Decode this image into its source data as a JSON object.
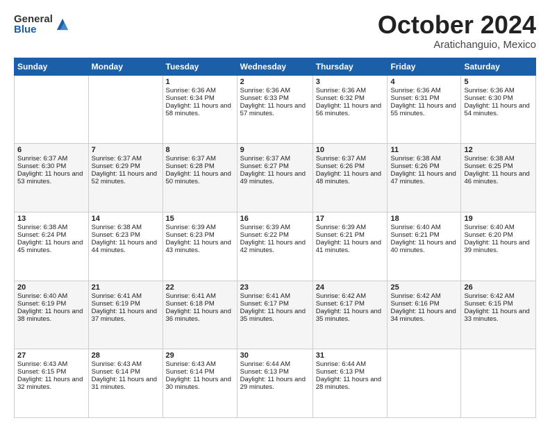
{
  "logo": {
    "general": "General",
    "blue": "Blue"
  },
  "title": "October 2024",
  "location": "Aratichanguio, Mexico",
  "header_days": [
    "Sunday",
    "Monday",
    "Tuesday",
    "Wednesday",
    "Thursday",
    "Friday",
    "Saturday"
  ],
  "weeks": [
    [
      {
        "day": "",
        "sunrise": "",
        "sunset": "",
        "daylight": ""
      },
      {
        "day": "",
        "sunrise": "",
        "sunset": "",
        "daylight": ""
      },
      {
        "day": "1",
        "sunrise": "Sunrise: 6:36 AM",
        "sunset": "Sunset: 6:34 PM",
        "daylight": "Daylight: 11 hours and 58 minutes."
      },
      {
        "day": "2",
        "sunrise": "Sunrise: 6:36 AM",
        "sunset": "Sunset: 6:33 PM",
        "daylight": "Daylight: 11 hours and 57 minutes."
      },
      {
        "day": "3",
        "sunrise": "Sunrise: 6:36 AM",
        "sunset": "Sunset: 6:32 PM",
        "daylight": "Daylight: 11 hours and 56 minutes."
      },
      {
        "day": "4",
        "sunrise": "Sunrise: 6:36 AM",
        "sunset": "Sunset: 6:31 PM",
        "daylight": "Daylight: 11 hours and 55 minutes."
      },
      {
        "day": "5",
        "sunrise": "Sunrise: 6:36 AM",
        "sunset": "Sunset: 6:30 PM",
        "daylight": "Daylight: 11 hours and 54 minutes."
      }
    ],
    [
      {
        "day": "6",
        "sunrise": "Sunrise: 6:37 AM",
        "sunset": "Sunset: 6:30 PM",
        "daylight": "Daylight: 11 hours and 53 minutes."
      },
      {
        "day": "7",
        "sunrise": "Sunrise: 6:37 AM",
        "sunset": "Sunset: 6:29 PM",
        "daylight": "Daylight: 11 hours and 52 minutes."
      },
      {
        "day": "8",
        "sunrise": "Sunrise: 6:37 AM",
        "sunset": "Sunset: 6:28 PM",
        "daylight": "Daylight: 11 hours and 50 minutes."
      },
      {
        "day": "9",
        "sunrise": "Sunrise: 6:37 AM",
        "sunset": "Sunset: 6:27 PM",
        "daylight": "Daylight: 11 hours and 49 minutes."
      },
      {
        "day": "10",
        "sunrise": "Sunrise: 6:37 AM",
        "sunset": "Sunset: 6:26 PM",
        "daylight": "Daylight: 11 hours and 48 minutes."
      },
      {
        "day": "11",
        "sunrise": "Sunrise: 6:38 AM",
        "sunset": "Sunset: 6:26 PM",
        "daylight": "Daylight: 11 hours and 47 minutes."
      },
      {
        "day": "12",
        "sunrise": "Sunrise: 6:38 AM",
        "sunset": "Sunset: 6:25 PM",
        "daylight": "Daylight: 11 hours and 46 minutes."
      }
    ],
    [
      {
        "day": "13",
        "sunrise": "Sunrise: 6:38 AM",
        "sunset": "Sunset: 6:24 PM",
        "daylight": "Daylight: 11 hours and 45 minutes."
      },
      {
        "day": "14",
        "sunrise": "Sunrise: 6:38 AM",
        "sunset": "Sunset: 6:23 PM",
        "daylight": "Daylight: 11 hours and 44 minutes."
      },
      {
        "day": "15",
        "sunrise": "Sunrise: 6:39 AM",
        "sunset": "Sunset: 6:23 PM",
        "daylight": "Daylight: 11 hours and 43 minutes."
      },
      {
        "day": "16",
        "sunrise": "Sunrise: 6:39 AM",
        "sunset": "Sunset: 6:22 PM",
        "daylight": "Daylight: 11 hours and 42 minutes."
      },
      {
        "day": "17",
        "sunrise": "Sunrise: 6:39 AM",
        "sunset": "Sunset: 6:21 PM",
        "daylight": "Daylight: 11 hours and 41 minutes."
      },
      {
        "day": "18",
        "sunrise": "Sunrise: 6:40 AM",
        "sunset": "Sunset: 6:21 PM",
        "daylight": "Daylight: 11 hours and 40 minutes."
      },
      {
        "day": "19",
        "sunrise": "Sunrise: 6:40 AM",
        "sunset": "Sunset: 6:20 PM",
        "daylight": "Daylight: 11 hours and 39 minutes."
      }
    ],
    [
      {
        "day": "20",
        "sunrise": "Sunrise: 6:40 AM",
        "sunset": "Sunset: 6:19 PM",
        "daylight": "Daylight: 11 hours and 38 minutes."
      },
      {
        "day": "21",
        "sunrise": "Sunrise: 6:41 AM",
        "sunset": "Sunset: 6:19 PM",
        "daylight": "Daylight: 11 hours and 37 minutes."
      },
      {
        "day": "22",
        "sunrise": "Sunrise: 6:41 AM",
        "sunset": "Sunset: 6:18 PM",
        "daylight": "Daylight: 11 hours and 36 minutes."
      },
      {
        "day": "23",
        "sunrise": "Sunrise: 6:41 AM",
        "sunset": "Sunset: 6:17 PM",
        "daylight": "Daylight: 11 hours and 35 minutes."
      },
      {
        "day": "24",
        "sunrise": "Sunrise: 6:42 AM",
        "sunset": "Sunset: 6:17 PM",
        "daylight": "Daylight: 11 hours and 35 minutes."
      },
      {
        "day": "25",
        "sunrise": "Sunrise: 6:42 AM",
        "sunset": "Sunset: 6:16 PM",
        "daylight": "Daylight: 11 hours and 34 minutes."
      },
      {
        "day": "26",
        "sunrise": "Sunrise: 6:42 AM",
        "sunset": "Sunset: 6:15 PM",
        "daylight": "Daylight: 11 hours and 33 minutes."
      }
    ],
    [
      {
        "day": "27",
        "sunrise": "Sunrise: 6:43 AM",
        "sunset": "Sunset: 6:15 PM",
        "daylight": "Daylight: 11 hours and 32 minutes."
      },
      {
        "day": "28",
        "sunrise": "Sunrise: 6:43 AM",
        "sunset": "Sunset: 6:14 PM",
        "daylight": "Daylight: 11 hours and 31 minutes."
      },
      {
        "day": "29",
        "sunrise": "Sunrise: 6:43 AM",
        "sunset": "Sunset: 6:14 PM",
        "daylight": "Daylight: 11 hours and 30 minutes."
      },
      {
        "day": "30",
        "sunrise": "Sunrise: 6:44 AM",
        "sunset": "Sunset: 6:13 PM",
        "daylight": "Daylight: 11 hours and 29 minutes."
      },
      {
        "day": "31",
        "sunrise": "Sunrise: 6:44 AM",
        "sunset": "Sunset: 6:13 PM",
        "daylight": "Daylight: 11 hours and 28 minutes."
      },
      {
        "day": "",
        "sunrise": "",
        "sunset": "",
        "daylight": ""
      },
      {
        "day": "",
        "sunrise": "",
        "sunset": "",
        "daylight": ""
      }
    ]
  ]
}
